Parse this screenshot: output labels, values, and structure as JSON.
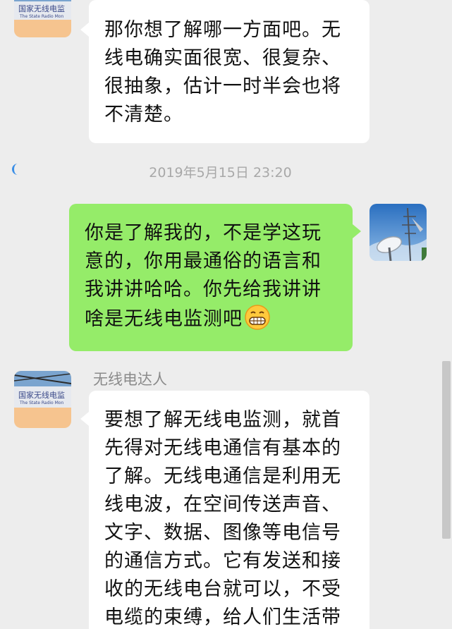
{
  "messages": [
    {
      "id": "msg1",
      "direction": "incoming",
      "text": "那你想了解哪一方面吧。无线电确实面很宽、很复杂、很抽象，估计一时半会也将不清楚。"
    },
    {
      "id": "msg2",
      "direction": "outgoing",
      "text": "你是了解我的，不是学这玩意的，你用最通俗的语言和我讲讲哈哈。你先给我讲讲啥是无线电监测吧",
      "emoji": "grimacing-face"
    },
    {
      "id": "msg3",
      "direction": "incoming",
      "sender": "无线电达人",
      "text": "要想了解无线电监测，就首先得对无线电通信有基本的了解。无线电通信是利用无线电波，在空间传送声音、文字、数据、图像等电信号的通信方式。它有发送和接收的无线电台就可以，不受电缆的束缚，给人们生活带"
    }
  ],
  "timestamp": "2019年5月15日 23:20",
  "avatars": {
    "contact_sign_line1": "国家无线电监",
    "contact_sign_line2": "The State Radio Mon"
  },
  "colors": {
    "background": "#ededed",
    "incoming_bubble": "#ffffff",
    "outgoing_bubble": "#95ec69",
    "timestamp": "#a8a8a8"
  }
}
